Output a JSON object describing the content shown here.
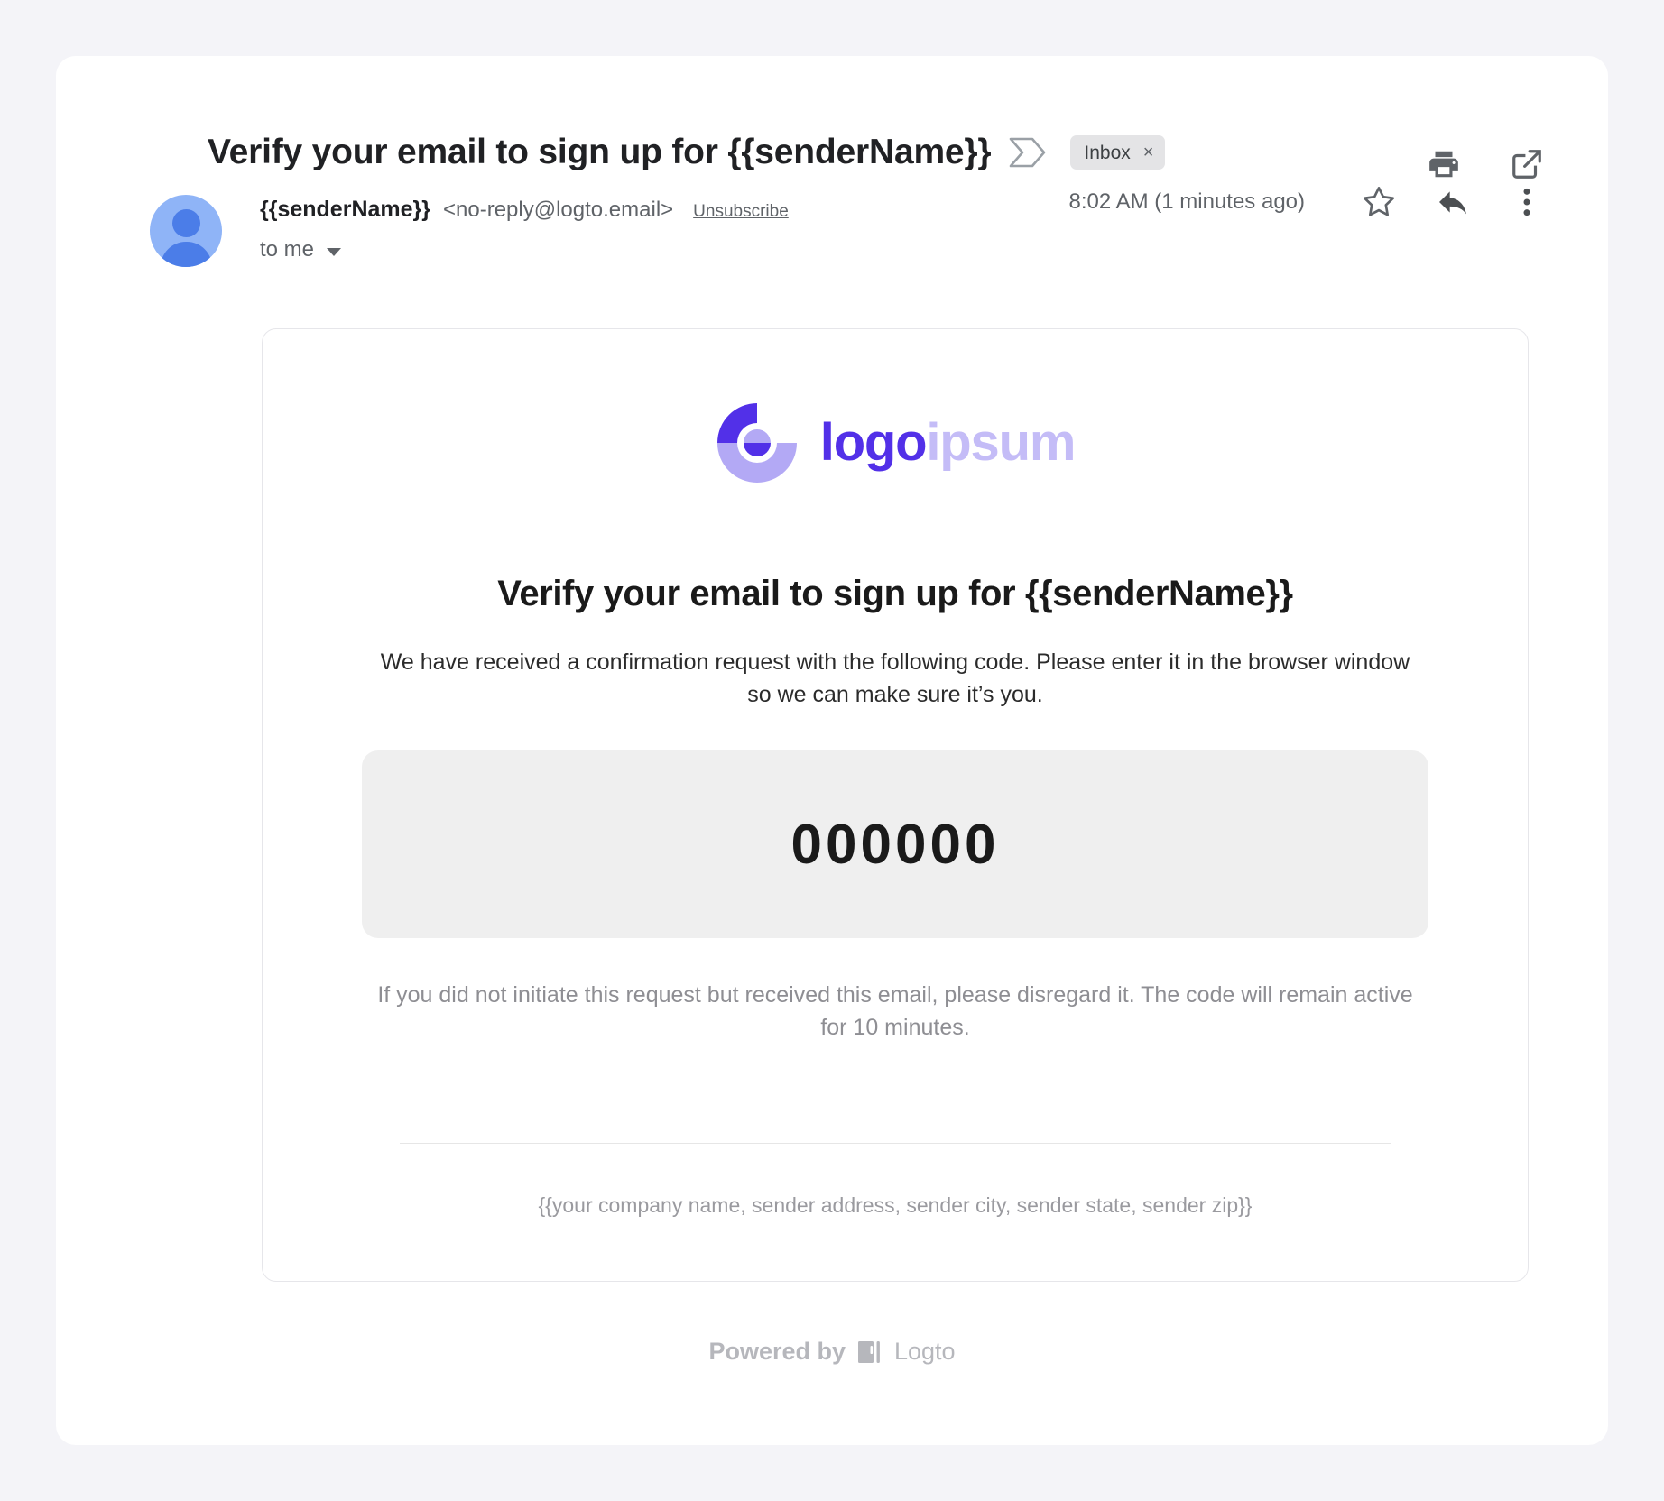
{
  "header": {
    "subject": "Verify your email to sign up for {{senderName}}",
    "label_chevron_icon": "label-chevron-icon",
    "inbox_chip": {
      "label": "Inbox",
      "close": "×"
    },
    "actions": [
      {
        "name": "print-icon",
        "label": "Print"
      },
      {
        "name": "open-in-new-icon",
        "label": "Open in new window"
      }
    ]
  },
  "sender": {
    "avatar_icon": "default-avatar",
    "name": "{{senderName}}",
    "email": "<no-reply@logto.email>",
    "unsubscribe": "Unsubscribe",
    "to": "to me",
    "timestamp": "8:02 AM (1 minutes ago)",
    "actions": [
      {
        "name": "star-icon",
        "label": "Star"
      },
      {
        "name": "reply-icon",
        "label": "Reply"
      },
      {
        "name": "more-options-icon",
        "label": "More"
      }
    ]
  },
  "email": {
    "logo": {
      "mark_icon": "logoipsum-mark",
      "text_primary": "logo",
      "text_secondary": "ipsum",
      "color_primary": "#5230e8",
      "color_secondary": "#c4bcf7"
    },
    "heading": "Verify your email to sign up for {{senderName}}",
    "paragraph": "We have received a confirmation request with the following code. Please enter it in the browser window so we can make sure it’s you.",
    "code": "000000",
    "code_box_color": "#efefef",
    "disclaimer": "If you did not initiate this request but received this email, please disregard it. The code will remain active for 10 minutes.",
    "address": "{{your company name, sender address, sender city, sender state, sender zip}}"
  },
  "footer": {
    "powered_by": "Powered by",
    "brand_icon": "logto-icon",
    "brand": "Logto"
  }
}
